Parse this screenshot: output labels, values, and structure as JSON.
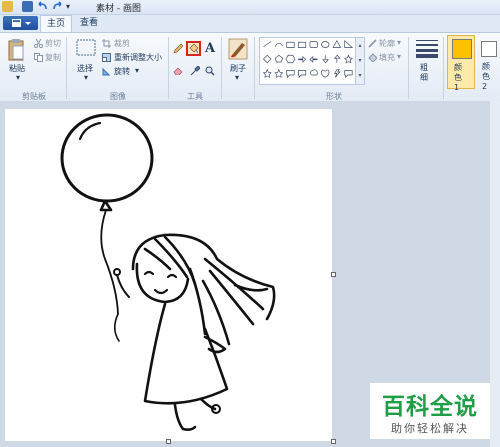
{
  "window": {
    "title": "素材 - 画图"
  },
  "tabs": {
    "home": "主页",
    "view": "查看"
  },
  "clipboard": {
    "paste": "粘贴",
    "cut": "剪切",
    "copy": "复制",
    "group": "剪贴板"
  },
  "image": {
    "select": "选择",
    "crop": "裁剪",
    "resize": "重新调整大小",
    "rotate": "旋转",
    "group": "图像"
  },
  "tools": {
    "group": "工具",
    "text_glyph": "A"
  },
  "brushes": {
    "label": "刷子"
  },
  "shapes": {
    "outline": "轮廓",
    "fill": "填充",
    "group": "形状"
  },
  "size": {
    "label": "粗细"
  },
  "colors": {
    "color1": "颜色 1",
    "color2": "颜色 2",
    "color1_value": "#ffc000",
    "color2_value": "#ffffff"
  },
  "watermark": {
    "title": "百科全说",
    "subtitle": "助你轻松解决"
  },
  "accent": {
    "ribbon_blue": "#1f4e9c",
    "highlight_red": "#d9261c",
    "watermark_green": "#1f9e47"
  }
}
